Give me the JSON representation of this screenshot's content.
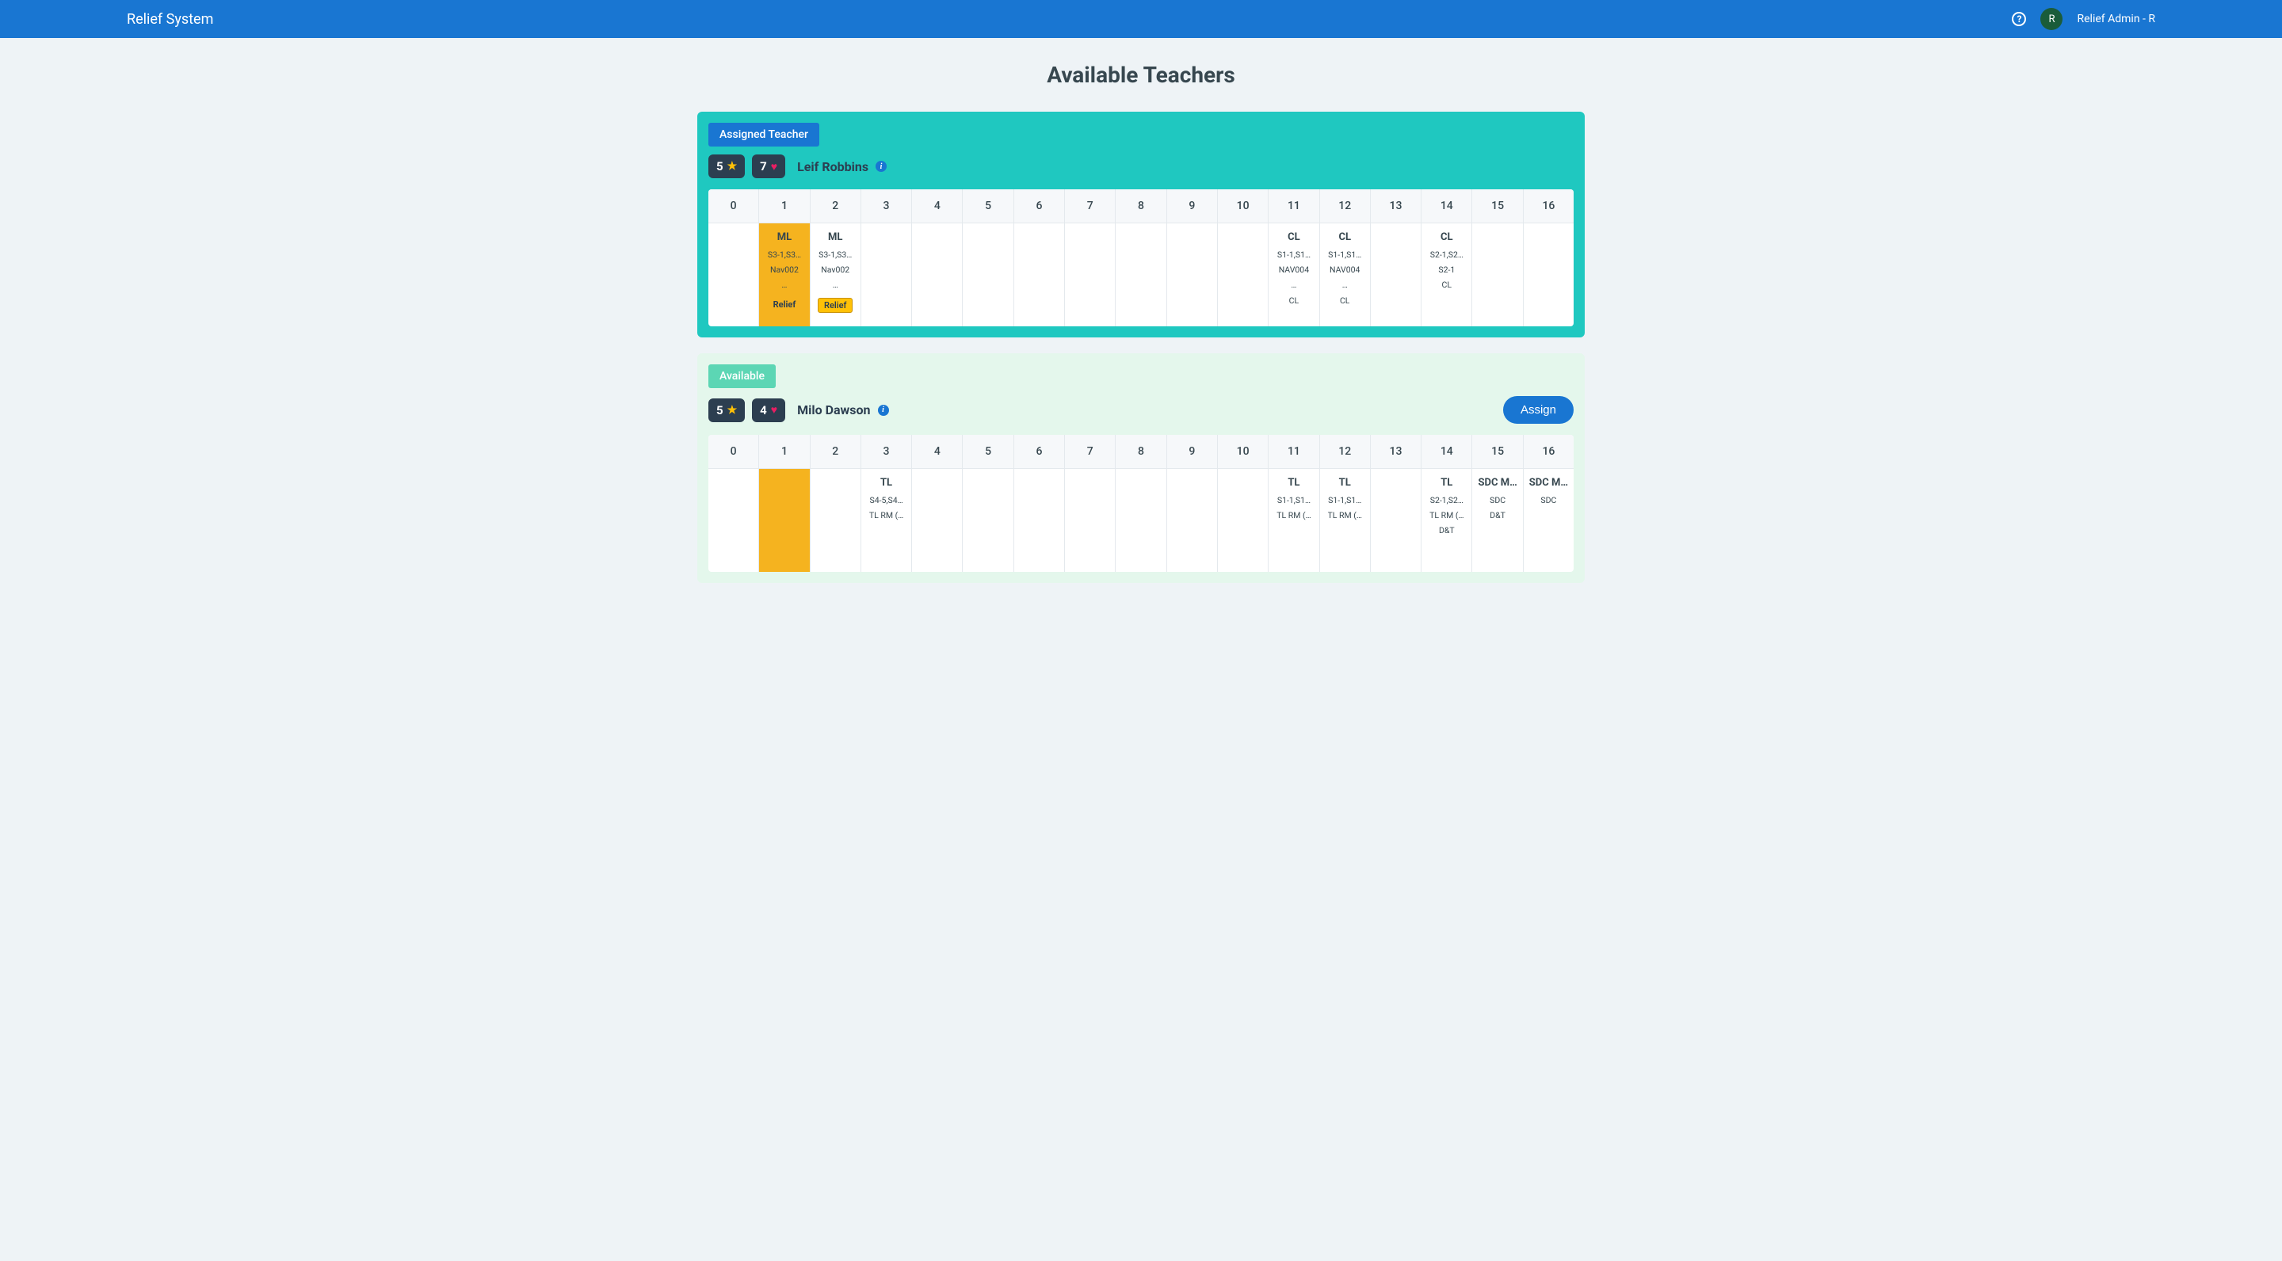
{
  "header": {
    "title": "Relief System",
    "user": "Relief Admin - R",
    "avatar_initial": "R"
  },
  "page": {
    "title": "Available Teachers"
  },
  "labels": {
    "assigned": "Assigned Teacher",
    "available": "Available",
    "assign_btn": "Assign",
    "relief": "Relief"
  },
  "periods": [
    "0",
    "1",
    "2",
    "3",
    "4",
    "5",
    "6",
    "7",
    "8",
    "9",
    "10",
    "11",
    "12",
    "13",
    "14",
    "15",
    "16"
  ],
  "teachers": [
    {
      "status": "assigned",
      "stars": "5",
      "hearts": "7",
      "name": "Leif Robbins",
      "slots": {
        "1": {
          "highlight": true,
          "title": "ML",
          "lines": [
            "S3-1,S3…",
            "Nav002",
            "…"
          ],
          "relief": true
        },
        "2": {
          "title": "ML",
          "lines": [
            "S3-1,S3…",
            "Nav002",
            "…"
          ],
          "relief": true
        },
        "11": {
          "title": "CL",
          "lines": [
            "S1-1,S1…",
            "NAV004",
            "…",
            "CL"
          ]
        },
        "12": {
          "title": "CL",
          "lines": [
            "S1-1,S1…",
            "NAV004",
            "…",
            "CL"
          ]
        },
        "14": {
          "title": "CL",
          "lines": [
            "S2-1,S2…",
            "S2-1",
            "CL"
          ]
        }
      }
    },
    {
      "status": "available",
      "stars": "5",
      "hearts": "4",
      "name": "Milo Dawson",
      "slots": {
        "1": {
          "highlight": true
        },
        "3": {
          "title": "TL",
          "lines": [
            "S4-5,S4…",
            "TL RM (…"
          ]
        },
        "11": {
          "title": "TL",
          "lines": [
            "S1-1,S1…",
            "TL RM (…"
          ]
        },
        "12": {
          "title": "TL",
          "lines": [
            "S1-1,S1…",
            "TL RM (…"
          ]
        },
        "14": {
          "title": "TL",
          "lines": [
            "S2-1,S2…",
            "TL RM (…",
            "D&T"
          ]
        },
        "15": {
          "title": "SDC M…",
          "lines": [
            "SDC",
            "D&T"
          ]
        },
        "16": {
          "title": "SDC M…",
          "lines": [
            "SDC"
          ]
        }
      }
    }
  ]
}
